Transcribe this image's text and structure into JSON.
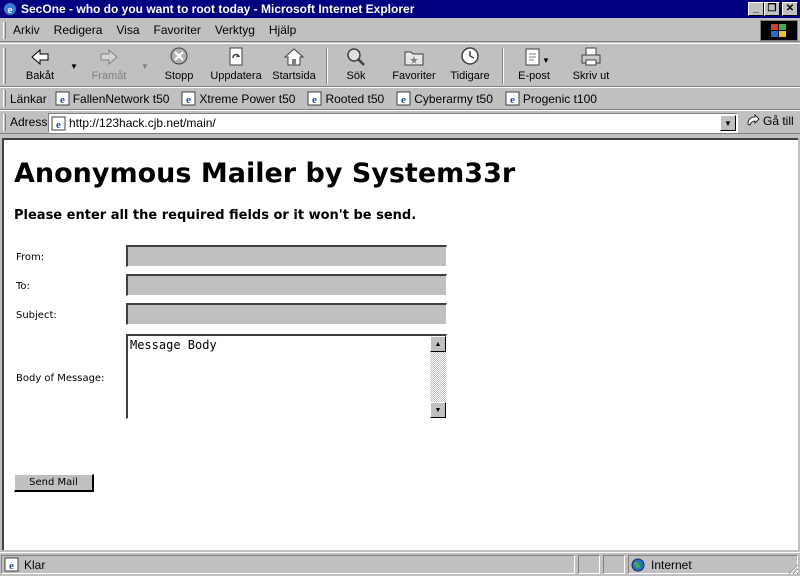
{
  "window": {
    "title": "SecOne - who do you want to root today - Microsoft Internet Explorer",
    "buttons": {
      "minimize": "_",
      "restore": "❐",
      "close": "✕"
    }
  },
  "menubar": {
    "items": [
      "Arkiv",
      "Redigera",
      "Visa",
      "Favoriter",
      "Verktyg",
      "Hjälp"
    ]
  },
  "toolbar": {
    "back": "Bakåt",
    "forward": "Framåt",
    "stop": "Stopp",
    "refresh": "Uppdatera",
    "home": "Startsida",
    "search": "Sök",
    "favorites": "Favoriter",
    "history": "Tidigare",
    "mail": "E-post",
    "print": "Skriv ut"
  },
  "links": {
    "label": "Länkar",
    "items": [
      "FallenNetwork t50",
      "Xtreme Power t50",
      "Rooted t50",
      "Cyberarmy t50",
      "Progenic t100"
    ]
  },
  "address": {
    "label": "Adress",
    "url": "http://123hack.cjb.net/main/",
    "go": "Gå till"
  },
  "page": {
    "title": "Anonymous Mailer by System33r",
    "subtitle": "Please enter all the required fields or it won't be send.",
    "from_label": "From:",
    "to_label": "To:",
    "subject_label": "Subject:",
    "body_label": "Body of Message:",
    "from_value": "",
    "to_value": "",
    "subject_value": "",
    "body_value": "Message Body",
    "send_label": "Send Mail"
  },
  "status": {
    "text": "Klar",
    "zone": "Internet"
  },
  "colors": {
    "titlebar": "#000080",
    "chrome": "#c0c0c0",
    "page_bg": "#ffffff"
  }
}
